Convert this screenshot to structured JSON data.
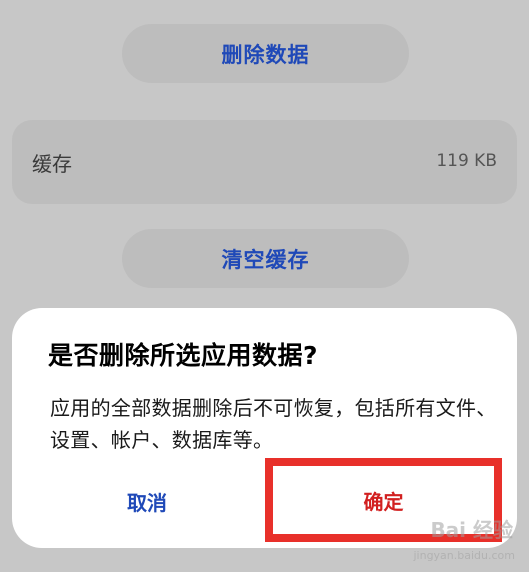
{
  "buttons": {
    "delete_data": "删除数据",
    "clear_cache": "清空缓存"
  },
  "cache": {
    "label": "缓存",
    "value": "119 KB"
  },
  "dialog": {
    "title": "是否删除所选应用数据?",
    "message": "应用的全部数据删除后不可恢复，包括所有文件、设置、帐户、数据库等。",
    "cancel": "取消",
    "confirm": "确定"
  },
  "watermark": {
    "logo": "Bai 经验",
    "sub": "jingyan.baidu.com"
  },
  "colors": {
    "background": "#c7c7c7",
    "card": "#bdbdbd",
    "accent_blue": "#1f49b8",
    "confirm_red": "#d22020",
    "highlight_border": "#e8302a"
  }
}
